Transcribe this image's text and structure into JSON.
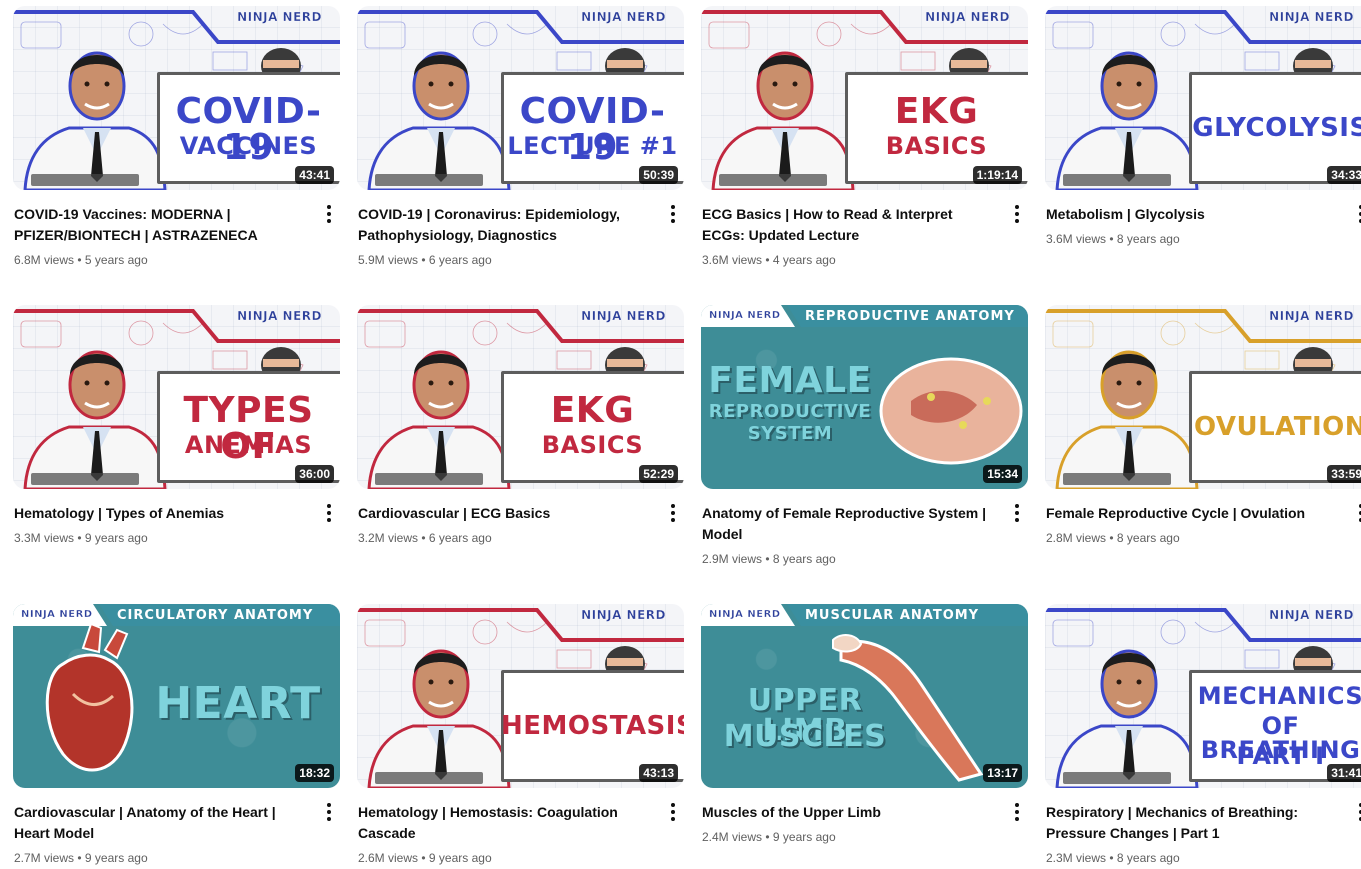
{
  "videos": [
    {
      "title": "COVID-19 Vaccines: MODERNA | PFIZER/BIONTECH | ASTRAZENECA",
      "views": "6.8M views",
      "age": "5 years ago",
      "duration": "43:41",
      "thumb_text": [
        "COVID-19",
        "VACCINES"
      ],
      "style": "presenter",
      "accent": "#3b47c8",
      "logo": "NINJA NERD"
    },
    {
      "title": "COVID-19 | Coronavirus: Epidemiology, Pathophysiology, Diagnostics",
      "views": "5.9M views",
      "age": "6 years ago",
      "duration": "50:39",
      "thumb_text": [
        "COVID-19",
        "LECTURE #1"
      ],
      "style": "presenter",
      "accent": "#3b47c8",
      "logo": "NINJA NERD"
    },
    {
      "title": "ECG Basics | How to Read & Interpret ECGs: Updated Lecture",
      "views": "3.6M views",
      "age": "4 years ago",
      "duration": "1:19:14",
      "thumb_text": [
        "EKG",
        "BASICS"
      ],
      "style": "presenter",
      "accent": "#c1283f",
      "logo": "NINJA NERD"
    },
    {
      "title": "Metabolism | Glycolysis",
      "views": "3.6M views",
      "age": "8 years ago",
      "duration": "34:33",
      "thumb_text": [
        "GLYCOLYSIS"
      ],
      "style": "presenter",
      "accent": "#3b47c8",
      "logo": "NINJA NERD"
    },
    {
      "title": "Hematology | Types of Anemias",
      "views": "3.3M views",
      "age": "9 years ago",
      "duration": "36:00",
      "thumb_text": [
        "TYPES OF",
        "ANEMIAS"
      ],
      "style": "presenter",
      "accent": "#c1283f",
      "logo": "NINJA NERD"
    },
    {
      "title": "Cardiovascular | ECG Basics",
      "views": "3.2M views",
      "age": "6 years ago",
      "duration": "52:29",
      "thumb_text": [
        "EKG",
        "BASICS"
      ],
      "style": "presenter",
      "accent": "#c1283f",
      "logo": "NINJA NERD"
    },
    {
      "title": "Anatomy of Female Reproductive System | Model",
      "views": "2.9M views",
      "age": "8 years ago",
      "duration": "15:34",
      "thumb_text": [
        "FEMALE",
        "REPRODUCTIVE",
        "SYSTEM"
      ],
      "style": "anatomy",
      "accent": "#7fd3dc",
      "logo": "NINJA NERD",
      "strip": "REPRODUCTIVE ANATOMY"
    },
    {
      "title": "Female Reproductive Cycle | Ovulation",
      "views": "2.8M views",
      "age": "8 years ago",
      "duration": "33:59",
      "thumb_text": [
        "OVULATION"
      ],
      "style": "presenter",
      "accent": "#d8a02a",
      "logo": "NINJA NERD"
    },
    {
      "title": "Cardiovascular | Anatomy of the Heart | Heart Model",
      "views": "2.7M views",
      "age": "9 years ago",
      "duration": "18:32",
      "thumb_text": [
        "HEART"
      ],
      "style": "anatomy",
      "accent": "#7fd3dc",
      "logo": "NINJA NERD",
      "strip": "CIRCULATORY ANATOMY"
    },
    {
      "title": "Hematology | Hemostasis: Coagulation Cascade",
      "views": "2.6M views",
      "age": "9 years ago",
      "duration": "43:13",
      "thumb_text": [
        "HEMOSTASIS"
      ],
      "style": "presenter",
      "accent": "#c1283f",
      "logo": "NINJA NERD"
    },
    {
      "title": "Muscles of the Upper Limb",
      "views": "2.4M views",
      "age": "9 years ago",
      "duration": "13:17",
      "thumb_text": [
        "UPPER LIMB",
        "MUSCLES"
      ],
      "style": "anatomy",
      "accent": "#7fd3dc",
      "logo": "NINJA NERD",
      "strip": "MUSCULAR ANATOMY"
    },
    {
      "title": "Respiratory | Mechanics of Breathing: Pressure Changes | Part 1",
      "views": "2.3M views",
      "age": "8 years ago",
      "duration": "31:41",
      "thumb_text": [
        "MECHANICS",
        "OF BREATHING",
        "PART I"
      ],
      "style": "presenter",
      "accent": "#3b47c8",
      "logo": "NINJA NERD"
    }
  ],
  "stats_separator": " • ",
  "icons": {
    "menu": "more-vert-icon"
  }
}
